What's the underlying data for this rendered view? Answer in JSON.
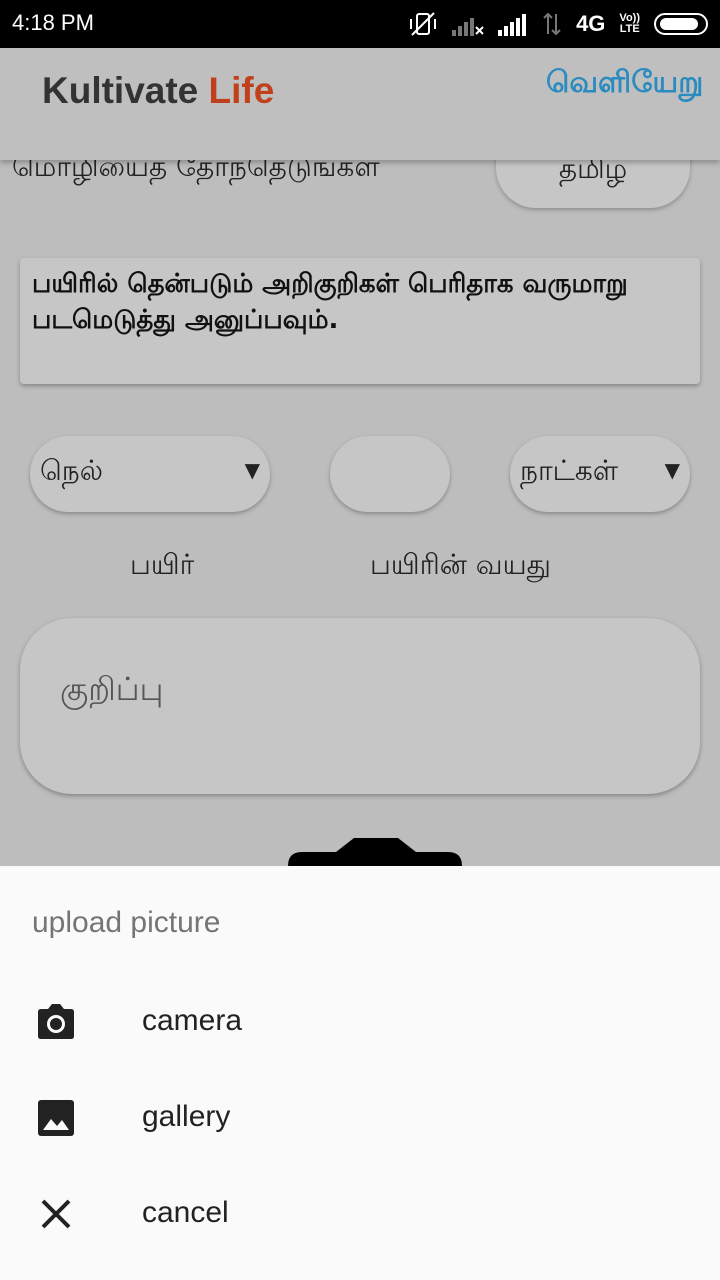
{
  "status_bar": {
    "time": "4:18 PM",
    "network": "4G",
    "volte": [
      "Vo))",
      "LTE"
    ],
    "icons": [
      "vibrate-off-icon",
      "signal-weak-icon",
      "signal-full-icon",
      "data-arrows-icon",
      "battery-icon"
    ]
  },
  "app_bar": {
    "title_part1": "Kultivate",
    "title_part2": "Life",
    "logout_label": "வெளியேறு",
    "accent_color": "#c0401c",
    "logout_color": "#2a8bc0"
  },
  "language": {
    "label": "மொழியைத் தேர்ந்தெடுங்கள்",
    "selected": "தமிழ"
  },
  "instruction": {
    "text": "பயிரில் தென்படும் அறிகுறிகள் பெரிதாக வருமாறு படமெடுத்து அனுப்பவும்."
  },
  "crop": {
    "selected": "நெல்",
    "label": "பயிர்"
  },
  "crop_age": {
    "value": "",
    "unit_selected": "நாட்கள்",
    "label": "பயிரின் வயது"
  },
  "note": {
    "placeholder": "குறிப்பு"
  },
  "sheet": {
    "title": "upload picture",
    "items": [
      {
        "label": "camera",
        "icon": "camera-icon"
      },
      {
        "label": "gallery",
        "icon": "gallery-icon"
      },
      {
        "label": "cancel",
        "icon": "close-icon"
      }
    ]
  }
}
